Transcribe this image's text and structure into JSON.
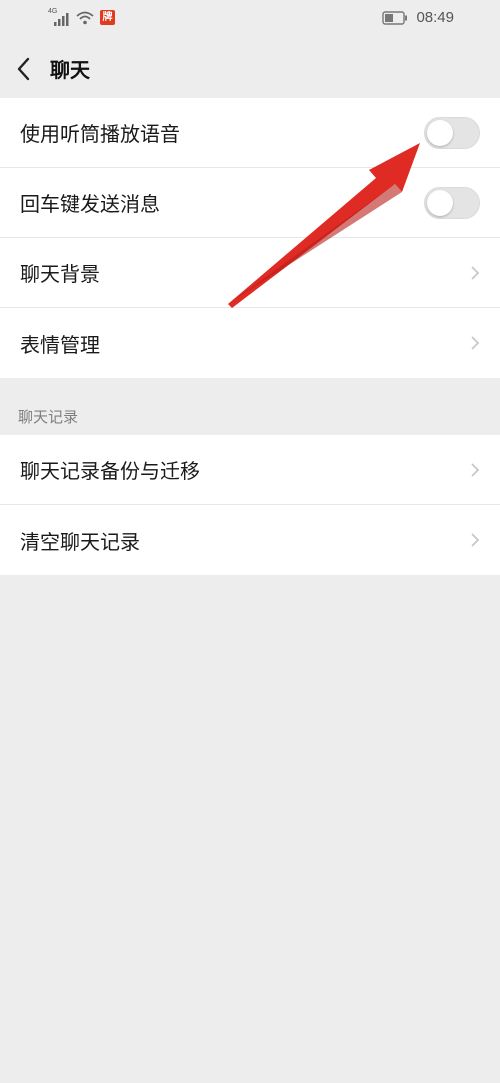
{
  "status_bar": {
    "network_label": "4G",
    "app_badge_text": "牌",
    "time": "08:49",
    "icons": [
      "signal-icon",
      "wifi-icon",
      "app-badge-icon",
      "battery-icon"
    ]
  },
  "nav": {
    "title": "聊天",
    "back_icon": "chevron-left-icon"
  },
  "settings_group": {
    "items": [
      {
        "label": "使用听筒播放语音",
        "control": "toggle",
        "state": "off"
      },
      {
        "label": "回车键发送消息",
        "control": "toggle",
        "state": "off"
      },
      {
        "label": "聊天背景",
        "control": "chevron"
      },
      {
        "label": "表情管理",
        "control": "chevron"
      }
    ]
  },
  "history_section": {
    "header": "聊天记录",
    "items": [
      {
        "label": "聊天记录备份与迁移",
        "control": "chevron"
      },
      {
        "label": "清空聊天记录",
        "control": "chevron"
      }
    ]
  },
  "annotation": {
    "arrow_color": "#e02b25"
  },
  "colors": {
    "background": "#ededed",
    "toggle_off": "#e4e4e4",
    "chevron": "#c8c8c8"
  }
}
